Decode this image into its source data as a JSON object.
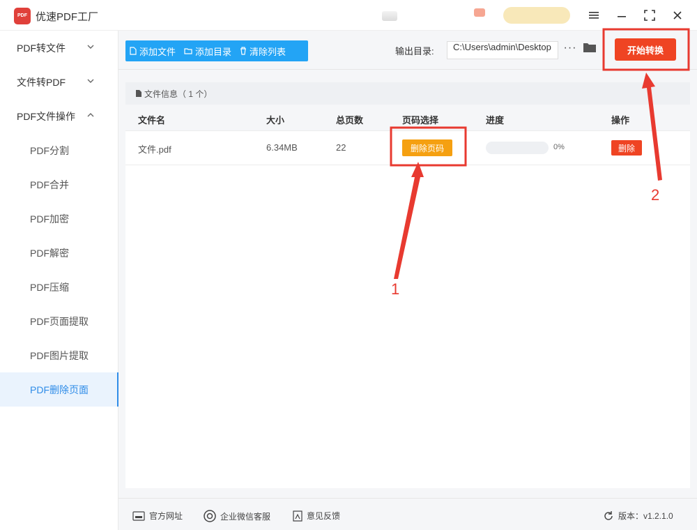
{
  "app": {
    "title": "优速PDF工厂",
    "logo_text": "PDF"
  },
  "sidebar": {
    "items": [
      {
        "label": "PDF转文件"
      },
      {
        "label": "文件转PDF"
      },
      {
        "label": "PDF文件操作"
      },
      {
        "label": "PDF分割"
      },
      {
        "label": "PDF合并"
      },
      {
        "label": "PDF加密"
      },
      {
        "label": "PDF解密"
      },
      {
        "label": "PDF压缩"
      },
      {
        "label": "PDF页面提取"
      },
      {
        "label": "PDF图片提取"
      },
      {
        "label": "PDF删除页面"
      }
    ]
  },
  "toolbar": {
    "add_file": "添加文件",
    "add_dir": "添加目录",
    "clear_list": "清除列表",
    "output_label": "输出目录:",
    "output_path": "C:\\Users\\admin\\Desktop",
    "more": "···",
    "start": "开始转换"
  },
  "panel": {
    "title": "文件信息",
    "count": "（ 1 个）"
  },
  "table": {
    "headers": [
      "文件名",
      "大小",
      "总页数",
      "页码选择",
      "进度",
      "操作"
    ],
    "rows": [
      {
        "name": "文件.pdf",
        "size": "6.34MB",
        "pages": "22",
        "page_select": "删除页码",
        "progress": 0,
        "progress_text": "0%",
        "action": "删除"
      }
    ]
  },
  "footer": {
    "website": "官方网址",
    "wechat": "企业微信客服",
    "feedback": "意见反馈",
    "version": "版本：v1.2.1.0"
  },
  "annotations": {
    "step1": "1",
    "step2": "2"
  },
  "colors": {
    "primary": "#23a4f5",
    "accent": "#ef4423",
    "orange": "#f5a011",
    "annotation": "#e83a30"
  }
}
